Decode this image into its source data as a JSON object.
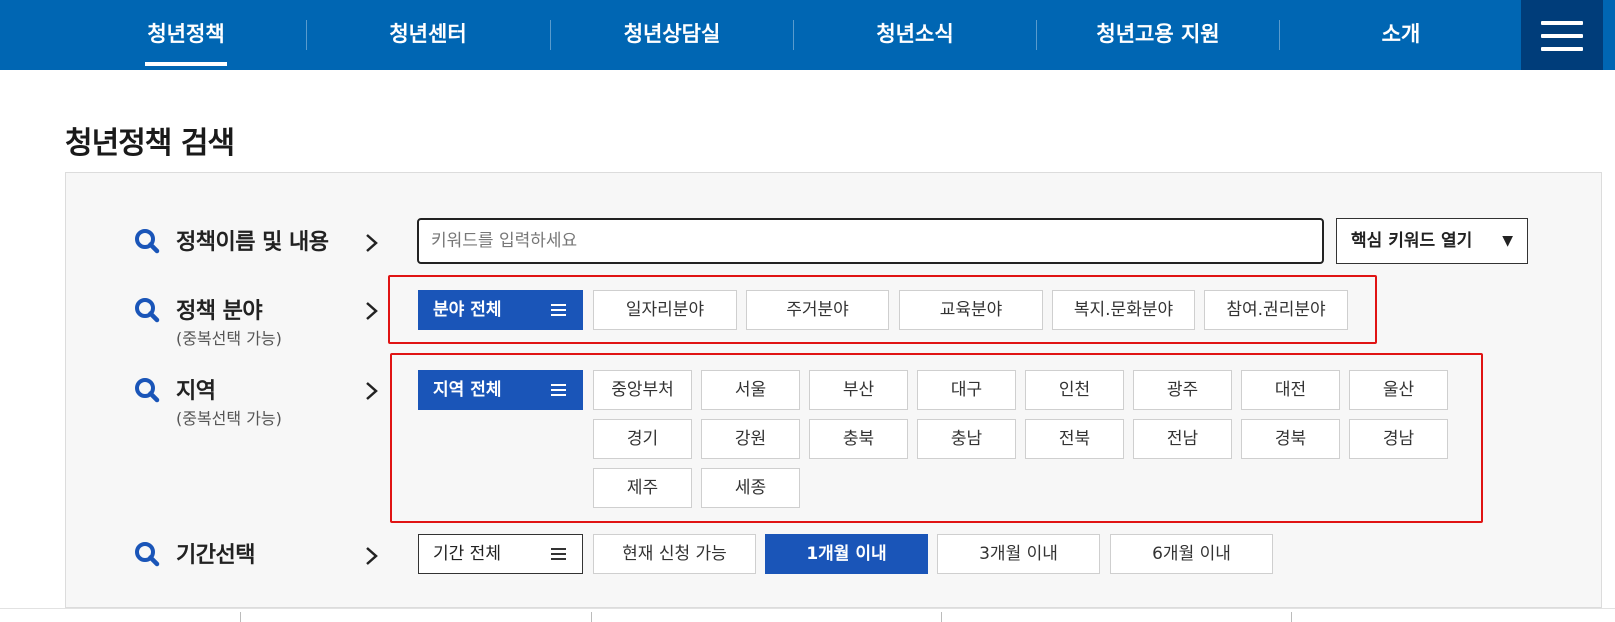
{
  "nav": {
    "items": [
      "청년정책",
      "청년센터",
      "청년상담실",
      "청년소식",
      "청년고용 지원",
      "소개"
    ],
    "active_index": 0,
    "menu_icon": "hamburger-icon"
  },
  "page_title": "청년정책 검색",
  "search": {
    "label": "정책이름 및 내용",
    "placeholder": "키워드를 입력하세요",
    "value": "",
    "keyword_button": "핵심 키워드 열기",
    "keyword_toggle_icon": "triangle-down-icon"
  },
  "field": {
    "label": "정책 분야",
    "sublabel": "(중복선택 가능)",
    "all_label": "분야 전체",
    "options": [
      "일자리분야",
      "주거분야",
      "교육분야",
      "복지.문화분야",
      "참여.권리분야"
    ]
  },
  "region": {
    "label": "지역",
    "sublabel": "(중복선택 가능)",
    "all_label": "지역 전체",
    "options": [
      "중앙부처",
      "서울",
      "부산",
      "대구",
      "인천",
      "광주",
      "대전",
      "울산",
      "경기",
      "강원",
      "충북",
      "충남",
      "전북",
      "전남",
      "경북",
      "경남",
      "제주",
      "세종"
    ]
  },
  "period": {
    "label": "기간선택",
    "all_label": "기간 전체",
    "options": [
      "현재 신청 가능",
      "1개월 이내",
      "3개월 이내",
      "6개월 이내"
    ],
    "selected": "1개월 이내"
  },
  "colors": {
    "nav_bg": "#0066b3",
    "menu_bg": "#003d7a",
    "accent_blue": "#1a55b8",
    "highlight_red": "#e01414"
  }
}
